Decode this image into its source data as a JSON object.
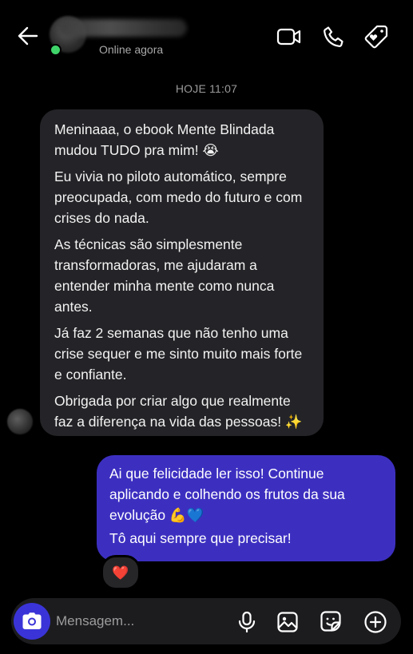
{
  "header": {
    "status": "Online agora",
    "icons": {
      "back": "arrow-left-icon",
      "video": "video-camera-icon",
      "phone": "phone-icon",
      "sticker_tag": "tag-heart-icon"
    }
  },
  "thread": {
    "timestamp": "HOJE 11:07",
    "incoming": {
      "paragraphs": [
        "Meninaaa, o ebook Mente Blindada mudou TUDO pra mim! 😭",
        "Eu vivia no piloto automático, sempre preocupada, com medo do futuro e com crises do nada.",
        "As técnicas são simplesmente transformadoras, me ajudaram a entender minha mente como nunca antes.",
        "Já faz 2 semanas que não tenho uma crise sequer e me sinto muito mais forte e confiante.",
        "Obrigada por criar algo que realmente faz a diferença na vida das pessoas! ✨"
      ]
    },
    "outgoing": {
      "paragraphs": [
        "Ai que felicidade ler isso! Continue aplicando e colhendo os frutos da sua evolução 💪💙",
        "Tô aqui sempre que precisar!"
      ],
      "reaction": "❤️"
    }
  },
  "composer": {
    "placeholder": "Mensagem...",
    "icons": {
      "camera": "camera-icon",
      "mic": "microphone-icon",
      "gallery": "image-icon",
      "sticker": "sticker-icon",
      "plus": "plus-circle-icon"
    }
  },
  "colors": {
    "background": "#000000",
    "incoming_bubble": "#242428",
    "outgoing_bubble": "#3c2fc0",
    "camera_button": "#3a34d8",
    "online": "#3fd46a"
  }
}
